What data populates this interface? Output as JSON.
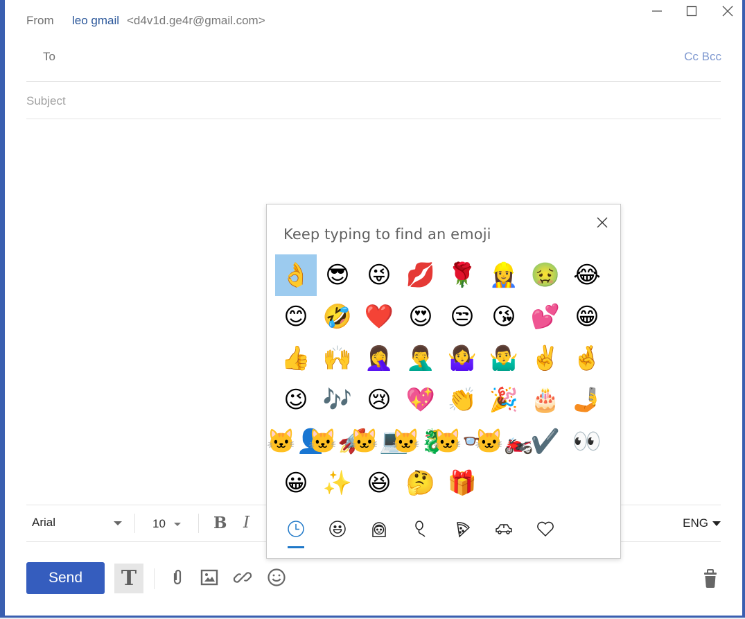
{
  "window": {
    "controls": {
      "minimize": "minimize",
      "maximize": "maximize",
      "close": "close"
    }
  },
  "header": {
    "from_label": "From",
    "from_name": "leo gmail",
    "from_email": "<d4v1d.ge4r@gmail.com>",
    "to_label": "To",
    "to_value": "",
    "cc_bcc": "Cc Bcc",
    "subject_placeholder": "Subject",
    "subject_value": ""
  },
  "format_bar": {
    "font": "Arial",
    "size": "10",
    "bold": "B",
    "italic": "I",
    "language": "ENG"
  },
  "actions": {
    "send": "Send",
    "text_format": "T",
    "icons": [
      "attach-icon",
      "image-icon",
      "link-icon",
      "emoji-icon",
      "trash-icon"
    ]
  },
  "emoji_panel": {
    "search_placeholder": "Keep typing to find an emoji",
    "selected_index": 0,
    "emojis": [
      "👌",
      "😎",
      "😜",
      "💋",
      "🌹",
      "👷‍♀️",
      "🤢",
      "😂",
      "😊",
      "🤣",
      "❤️",
      "😍",
      "😒",
      "😘",
      "💕",
      "😁",
      "👍",
      "🙌",
      "🤦‍♀️",
      "🤦‍♂️",
      "🤷‍♀️",
      "🤷‍♂️",
      "✌️",
      "🤞",
      "😉",
      "🎶",
      "😢",
      "💖",
      "👏",
      "🎉",
      "🎂",
      "🤳",
      "🐱‍👤",
      "🐱‍🚀",
      "🐱‍💻",
      "🐱‍🐉",
      "🐱‍👓",
      "🐱‍🏍",
      "✔️",
      "👀",
      "😀",
      "✨",
      "😆",
      "🤔",
      "🎁"
    ],
    "tabs": [
      {
        "name": "recent",
        "icon": "clock-icon",
        "active": true
      },
      {
        "name": "smileys",
        "icon": "smiley-icon",
        "active": false
      },
      {
        "name": "people",
        "icon": "person-icon",
        "active": false
      },
      {
        "name": "celebration",
        "icon": "balloon-icon",
        "active": false
      },
      {
        "name": "food",
        "icon": "pizza-icon",
        "active": false
      },
      {
        "name": "travel",
        "icon": "car-icon",
        "active": false
      },
      {
        "name": "symbols",
        "icon": "heart-icon",
        "active": false
      }
    ]
  },
  "colors": {
    "accent": "#355dbe",
    "window_border": "#3a5fb0",
    "selected_emoji_bg": "#9ccbef",
    "active_tab": "#1f78c8",
    "link_name": "#2b579a",
    "cc_bcc": "#7d97cf"
  }
}
